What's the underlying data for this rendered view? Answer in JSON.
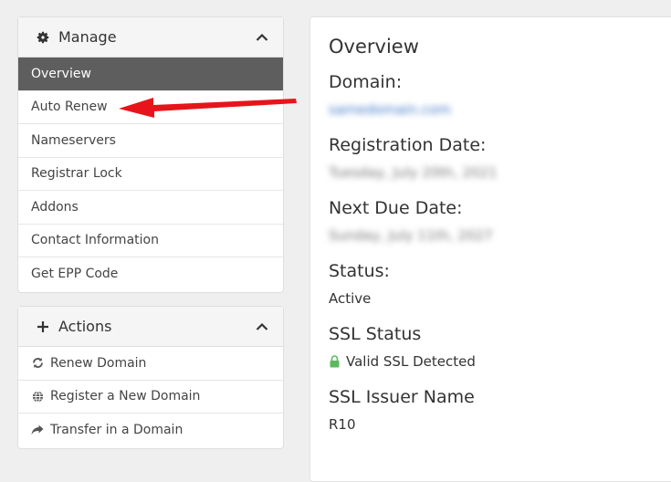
{
  "manage": {
    "title": "Manage",
    "items": [
      {
        "label": "Overview",
        "active": true
      },
      {
        "label": "Auto Renew"
      },
      {
        "label": "Nameservers"
      },
      {
        "label": "Registrar Lock"
      },
      {
        "label": "Addons"
      },
      {
        "label": "Contact Information"
      },
      {
        "label": "Get EPP Code"
      }
    ]
  },
  "actions": {
    "title": "Actions",
    "items": [
      {
        "label": "Renew Domain",
        "icon": "refresh-icon"
      },
      {
        "label": "Register a New Domain",
        "icon": "globe-icon"
      },
      {
        "label": "Transfer in a Domain",
        "icon": "share-icon"
      }
    ]
  },
  "overview": {
    "title": "Overview",
    "domain_label": "Domain:",
    "domain_value": "samedomain.com",
    "registration_label": "Registration Date:",
    "registration_value": "Tuesday, July 20th, 2021",
    "next_due_label": "Next Due Date:",
    "next_due_value": "Sunday, July 11th, 2027",
    "status_label": "Status:",
    "status_value": "Active",
    "ssl_status_label": "SSL Status",
    "ssl_status_value": "Valid SSL Detected",
    "ssl_issuer_label": "SSL Issuer Name",
    "ssl_issuer_value": "R10"
  },
  "colors": {
    "active_item_bg": "#5e5e5e",
    "arrow": "#e8141b",
    "ssl_lock": "#5cb85c"
  }
}
